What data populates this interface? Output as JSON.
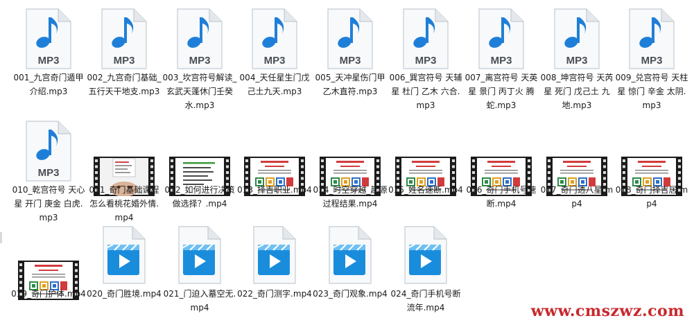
{
  "files": [
    {
      "name": "001_九宫奇门遁甲介绍.mp3",
      "icon": "mp3-audio-file-icon",
      "badge": "MP3"
    },
    {
      "name": "002_九宫奇门基础_五行天干地支.mp3",
      "icon": "mp3-audio-file-icon",
      "badge": "MP3"
    },
    {
      "name": "003_坎宫符号解读_玄武天蓬休门壬癸水.mp3",
      "icon": "mp3-audio-file-icon",
      "badge": "MP3"
    },
    {
      "name": "004_天任星生门戊己土九天.mp3",
      "icon": "mp3-audio-file-icon",
      "badge": "MP3"
    },
    {
      "name": "005_天冲星伤门甲乙木直符.mp3",
      "icon": "mp3-audio-file-icon",
      "badge": "MP3"
    },
    {
      "name": "006_巽宫符号 天辅星 杜门 乙木 六合.mp3",
      "icon": "mp3-audio-file-icon",
      "badge": "MP3"
    },
    {
      "name": "007_离宫符号 天英星 景门 丙丁火 腾蛇.mp3",
      "icon": "mp3-audio-file-icon",
      "badge": "MP3"
    },
    {
      "name": "008_坤宫符号 天芮星 死门 戊己土 九地.mp3",
      "icon": "mp3-audio-file-icon",
      "badge": "MP3"
    },
    {
      "name": "009_兑宫符号 天柱星 惊门 辛金 太阴.mp3",
      "icon": "mp3-audio-file-icon",
      "badge": "MP3"
    },
    {
      "name": "010_乾宫符号 天心星 开门 庚金 白虎.mp3",
      "icon": "mp3-audio-file-icon",
      "badge": "MP3"
    },
    {
      "name": "011_奇门基础课程 怎么看桃花婚外情.mp4",
      "icon": "video-thumbnail-icon",
      "thumb": "face"
    },
    {
      "name": "012_如何进行决策做选择？.mp4",
      "icon": "video-thumbnail-icon",
      "thumb": "doc"
    },
    {
      "name": "013_择吉职业.mp4",
      "icon": "video-thumbnail-icon",
      "thumb": "qr"
    },
    {
      "name": "014_时空穿越_起源过程结果.mp4",
      "icon": "video-thumbnail-icon",
      "thumb": "qr"
    },
    {
      "name": "015_姓名速断.mp4",
      "icon": "video-thumbnail-icon",
      "thumb": "qr"
    },
    {
      "name": "016_奇门手机号速断.mp4",
      "icon": "video-thumbnail-icon",
      "thumb": "qr"
    },
    {
      "name": "017_奇门透八星.mp4",
      "icon": "video-thumbnail-icon",
      "thumb": "qr"
    },
    {
      "name": "018_奇门择吉居.mp4",
      "icon": "video-thumbnail-icon",
      "thumb": "qr"
    },
    {
      "name": "019_奇门护体.mp4",
      "icon": "video-thumbnail-icon",
      "thumb": "qr"
    },
    {
      "name": "020_奇门胜境.mp4",
      "icon": "video-file-icon"
    },
    {
      "name": "021_门迫入墓空无.mp4",
      "icon": "video-file-icon"
    },
    {
      "name": "022_奇门测字.mp4",
      "icon": "video-file-icon"
    },
    {
      "name": "023_奇门观象.mp4",
      "icon": "video-file-icon"
    },
    {
      "name": "024_奇门手机号断流年.mp4",
      "icon": "video-file-icon"
    }
  ],
  "watermark": "www.cmszwz.com",
  "colors": {
    "accent": "#1f7fd8",
    "watermark": "#c8282c",
    "label": "#1a1a1a"
  }
}
